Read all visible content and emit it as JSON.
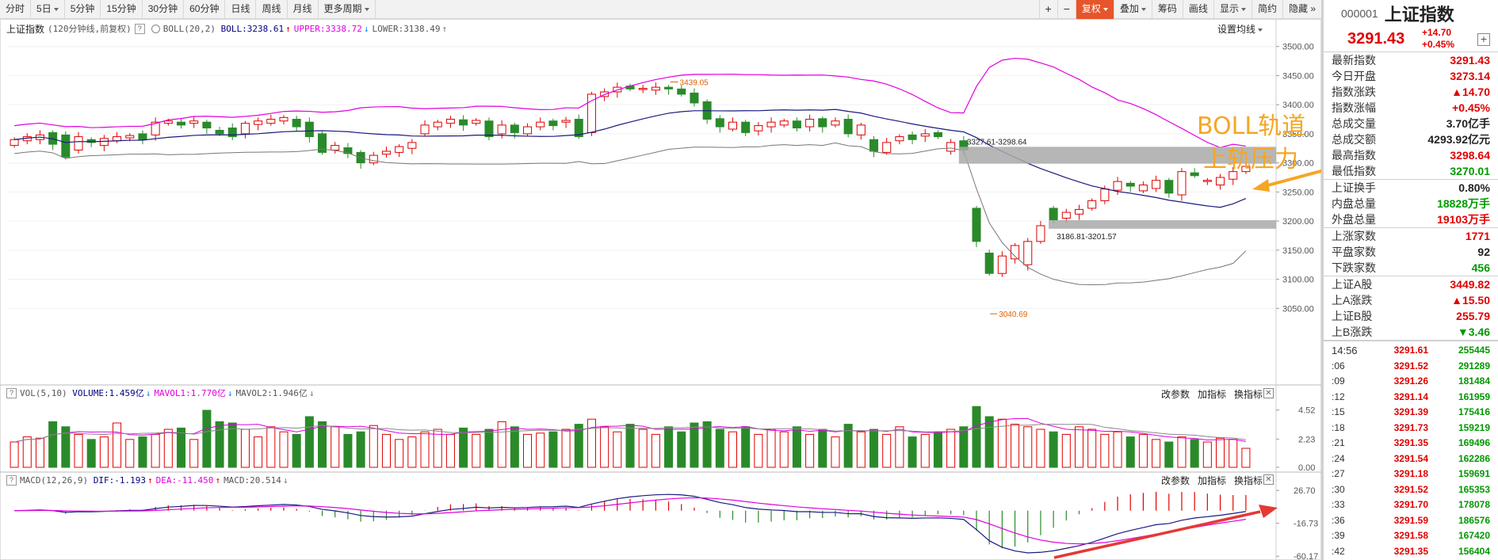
{
  "toolbar": {
    "periods": [
      "分时",
      "5日",
      "5分钟",
      "15分钟",
      "30分钟",
      "60分钟",
      "日线",
      "周线",
      "月线",
      "更多周期"
    ],
    "right": [
      "复权",
      "叠加",
      "筹码",
      "画线",
      "显示",
      "简约",
      "隐藏"
    ]
  },
  "main_panel": {
    "title": "上证指数",
    "note": "(120分钟线,前复权)",
    "boll_label": "BOLL(20,2)",
    "boll_value": "BOLL:3238.61",
    "upper_value": "UPPER:3338.72",
    "lower_value": "LOWER:3138.49",
    "settings": "设置均线",
    "y_ticks": [
      "3500.00",
      "3450.00",
      "3400.00",
      "3350.00",
      "3300.00",
      "3250.00",
      "3200.00",
      "3150.00",
      "3100.00",
      "3050.00"
    ],
    "high_label": "3439.05",
    "low_label": "3040.69",
    "zone1_label": "3327.61-3298.64",
    "zone2_label": "3186.81-3201.57"
  },
  "vol_panel": {
    "label": "VOL(5,10)",
    "volume": "VOLUME:1.459亿",
    "mavol1": "MAVOL1:1.770亿",
    "mavol2": "MAVOL2:1.946亿",
    "y_ticks": [
      "4.52",
      "2.23",
      "0.00"
    ]
  },
  "macd_panel": {
    "label": "MACD(12,26,9)",
    "dif": "DIF:-1.193",
    "dea": "DEA:-11.450",
    "macd": "MACD:20.514",
    "y_ticks": [
      "26.70",
      "-16.73",
      "-60.17"
    ]
  },
  "panel_tools": {
    "params": "改参数",
    "add": "加指标",
    "switch": "换指标"
  },
  "annotation": {
    "line1": "BOLL轨道",
    "line2": "上轨压力"
  },
  "quote": {
    "code": "000001",
    "name": "上证指数",
    "price": "3291.43",
    "change": "+14.70",
    "change_pct": "+0.45%",
    "rows": [
      {
        "k": "最新指数",
        "v": "3291.43",
        "c": "red"
      },
      {
        "k": "今日开盘",
        "v": "3273.14",
        "c": "red"
      },
      {
        "k": "指数涨跌",
        "v": "▲14.70",
        "c": "red"
      },
      {
        "k": "指数涨幅",
        "v": "+0.45%",
        "c": "red"
      },
      {
        "k": "总成交量",
        "v": "3.70亿手",
        "c": "blk"
      },
      {
        "k": "总成交额",
        "v": "4293.92亿元",
        "c": "blk"
      },
      {
        "k": "最高指数",
        "v": "3298.64",
        "c": "red"
      },
      {
        "k": "最低指数",
        "v": "3270.01",
        "c": "green"
      }
    ],
    "rows2": [
      {
        "k": "上证换手",
        "v": "0.80%",
        "c": "blk"
      },
      {
        "k": "内盘总量",
        "v": "18828万手",
        "c": "green"
      },
      {
        "k": "外盘总量",
        "v": "19103万手",
        "c": "red"
      }
    ],
    "rows3": [
      {
        "k": "上涨家数",
        "v": "1771",
        "c": "red"
      },
      {
        "k": "平盘家数",
        "v": "92",
        "c": "blk"
      },
      {
        "k": "下跌家数",
        "v": "456",
        "c": "green"
      }
    ],
    "rows4": [
      {
        "k": "上证A股",
        "v": "3449.82",
        "c": "red"
      },
      {
        "k": "上A涨跌",
        "v": "▲15.50",
        "c": "red"
      },
      {
        "k": "上证B股",
        "v": "255.79",
        "c": "red"
      },
      {
        "k": "上B涨跌",
        "v": "▼3.46",
        "c": "green"
      }
    ]
  },
  "ticks": [
    {
      "t": "14:56",
      "p": "3291.61",
      "v": "255445"
    },
    {
      "t": ":06",
      "p": "3291.52",
      "v": "291289"
    },
    {
      "t": ":09",
      "p": "3291.26",
      "v": "181484"
    },
    {
      "t": ":12",
      "p": "3291.14",
      "v": "161959"
    },
    {
      "t": ":15",
      "p": "3291.39",
      "v": "175416"
    },
    {
      "t": ":18",
      "p": "3291.73",
      "v": "159219"
    },
    {
      "t": ":21",
      "p": "3291.35",
      "v": "169496"
    },
    {
      "t": ":24",
      "p": "3291.54",
      "v": "162286"
    },
    {
      "t": ":27",
      "p": "3291.18",
      "v": "159691"
    },
    {
      "t": ":30",
      "p": "3291.52",
      "v": "165353"
    },
    {
      "t": ":33",
      "p": "3291.70",
      "v": "178078"
    },
    {
      "t": ":36",
      "p": "3291.59",
      "v": "186576"
    },
    {
      "t": ":39",
      "p": "3291.58",
      "v": "167420"
    },
    {
      "t": ":42",
      "p": "3291.35",
      "v": "156404"
    }
  ],
  "colors": {
    "up": "#e00000",
    "down": "#2a8a2a",
    "upper": "#e000e0",
    "mid": "#1a1a80",
    "lower": "#777777",
    "annotation": "#f5a623",
    "arrow": "#e53935"
  },
  "chart_data": {
    "type": "candlestick",
    "ylim": [
      3030,
      3520
    ],
    "candles": [
      [
        3330,
        3340
      ],
      [
        3338,
        3345
      ],
      [
        3340,
        3348
      ],
      [
        3352,
        3332
      ],
      [
        3348,
        3310
      ],
      [
        3322,
        3345
      ],
      [
        3340,
        3335
      ],
      [
        3330,
        3342
      ],
      [
        3338,
        3345
      ],
      [
        3343,
        3347
      ],
      [
        3350,
        3340
      ],
      [
        3348,
        3370
      ],
      [
        3368,
        3372
      ],
      [
        3370,
        3365
      ],
      [
        3368,
        3372
      ],
      [
        3370,
        3360
      ],
      [
        3356,
        3350
      ],
      [
        3360,
        3345
      ],
      [
        3350,
        3368
      ],
      [
        3366,
        3372
      ],
      [
        3368,
        3375
      ],
      [
        3372,
        3378
      ],
      [
        3375,
        3362
      ],
      [
        3370,
        3345
      ],
      [
        3350,
        3318
      ],
      [
        3322,
        3330
      ],
      [
        3326,
        3316
      ],
      [
        3318,
        3300
      ],
      [
        3300,
        3313
      ],
      [
        3315,
        3320
      ],
      [
        3318,
        3328
      ],
      [
        3325,
        3335
      ],
      [
        3350,
        3365
      ],
      [
        3362,
        3370
      ],
      [
        3368,
        3375
      ],
      [
        3374,
        3365
      ],
      [
        3368,
        3373
      ],
      [
        3372,
        3345
      ],
      [
        3350,
        3365
      ],
      [
        3365,
        3352
      ],
      [
        3350,
        3362
      ],
      [
        3362,
        3370
      ],
      [
        3372,
        3364
      ],
      [
        3370,
        3373
      ],
      [
        3375,
        3345
      ],
      [
        3352,
        3418
      ],
      [
        3414,
        3422
      ],
      [
        3422,
        3430
      ],
      [
        3432,
        3427
      ],
      [
        3426,
        3428
      ],
      [
        3425,
        3430
      ],
      [
        3430,
        3427
      ],
      [
        3427,
        3418
      ],
      [
        3420,
        3403
      ],
      [
        3405,
        3375
      ],
      [
        3376,
        3362
      ],
      [
        3358,
        3370
      ],
      [
        3370,
        3352
      ],
      [
        3355,
        3364
      ],
      [
        3362,
        3370
      ],
      [
        3365,
        3372
      ],
      [
        3372,
        3360
      ],
      [
        3362,
        3375
      ],
      [
        3376,
        3362
      ],
      [
        3365,
        3372
      ],
      [
        3375,
        3350
      ],
      [
        3348,
        3365
      ],
      [
        3340,
        3320
      ],
      [
        3318,
        3335
      ],
      [
        3338,
        3345
      ],
      [
        3348,
        3340
      ],
      [
        3346,
        3350
      ],
      [
        3352,
        3345
      ],
      [
        3320,
        3335
      ],
      [
        3338,
        3322
      ],
      [
        3222,
        3165
      ],
      [
        3145,
        3110
      ],
      [
        3110,
        3140
      ],
      [
        3135,
        3158
      ],
      [
        3125,
        3165
      ],
      [
        3165,
        3192
      ],
      [
        3222,
        3202
      ],
      [
        3205,
        3215
      ],
      [
        3212,
        3220
      ],
      [
        3222,
        3235
      ],
      [
        3235,
        3255
      ],
      [
        3253,
        3268
      ],
      [
        3265,
        3260
      ],
      [
        3252,
        3262
      ],
      [
        3256,
        3270
      ],
      [
        3270,
        3248
      ],
      [
        3245,
        3285
      ],
      [
        3283,
        3278
      ],
      [
        3268,
        3270
      ],
      [
        3262,
        3275
      ],
      [
        3272,
        3285
      ],
      [
        3285,
        3294
      ]
    ],
    "volumes": [
      2.0,
      2.4,
      2.3,
      3.6,
      3.2,
      2.6,
      2.2,
      2.4,
      3.5,
      2.2,
      2.4,
      2.6,
      3.0,
      3.1,
      2.2,
      4.5,
      3.6,
      3.5,
      3.0,
      2.4,
      3.2,
      2.8,
      2.6,
      4.0,
      3.6,
      3.2,
      2.6,
      2.8,
      3.3,
      2.6,
      2.2,
      2.4,
      2.8,
      3.0,
      2.6,
      3.1,
      2.6,
      3.0,
      3.6,
      3.2,
      2.6,
      2.7,
      2.8,
      3.0,
      3.4,
      3.8,
      3.2,
      2.8,
      3.4,
      3.0,
      2.6,
      3.2,
      2.8,
      3.5,
      3.6,
      3.0,
      2.8,
      3.2,
      2.6,
      3.0,
      2.8,
      3.2,
      2.6,
      3.0,
      2.4,
      3.4,
      2.8,
      3.0,
      2.6,
      3.2,
      2.4,
      2.6,
      2.8,
      3.0,
      3.2,
      4.8,
      4.0,
      3.8,
      3.4,
      3.2,
      3.0,
      2.8,
      2.6,
      3.2,
      3.0,
      2.6,
      2.8,
      2.4,
      2.6,
      2.2,
      2.0,
      2.4,
      2.2,
      2.0,
      2.3,
      2.2,
      1.5
    ]
  }
}
